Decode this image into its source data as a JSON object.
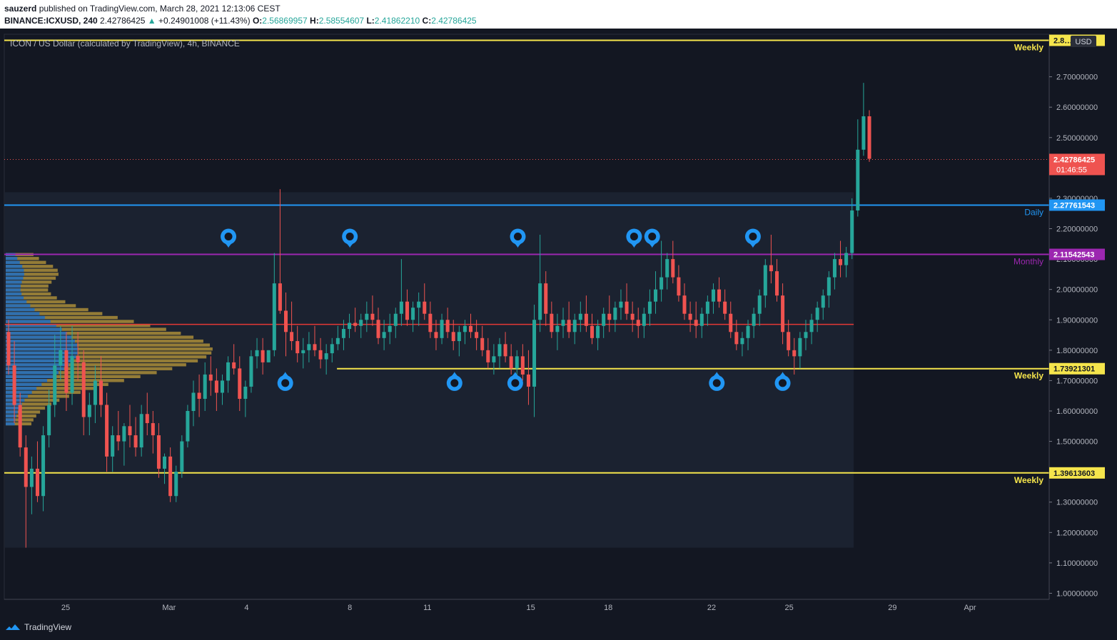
{
  "header": {
    "author": "sauzerd",
    "published_text": "published on TradingView.com, March 28, 2021 12:13:06 CEST",
    "symbol_tf": "BINANCE:ICXUSD, 240",
    "last": "2.42786425",
    "change": "+0.24901008 (+11.43%)",
    "o_label": "O:",
    "o": "2.56869957",
    "h_label": "H:",
    "h": "2.58554607",
    "l_label": "L:",
    "l": "2.41862210",
    "c_label": "C:",
    "c": "2.42786425"
  },
  "legend": "ICON / US Dollar (calculated by TradingView), 4h, BINANCE",
  "currency": "USD",
  "colors": {
    "up": "#26a69a",
    "down": "#ef5350",
    "bg": "#131722",
    "weekly": "#f5e54c",
    "daily": "#2196f3",
    "monthly": "#9c27b0",
    "poc": "#e53935",
    "marker": "#2196f3",
    "vp_up": "#1e6fc4",
    "vp_down": "#c7a33a"
  },
  "footer": {
    "brand": "TradingView",
    "logo_icon": "tradingview-cloud-icon"
  },
  "chart_data": {
    "type": "candlestick",
    "title": "ICON / US Dollar (calculated by TradingView), 4h, BINANCE",
    "ylim": [
      0.98,
      2.84
    ],
    "y_ticks": [
      1.0,
      1.1,
      1.2,
      1.3,
      1.4,
      1.5,
      1.6,
      1.7,
      1.8,
      1.9,
      2.0,
      2.1,
      2.2,
      2.3,
      2.5,
      2.6,
      2.7
    ],
    "y_tick_labels": [
      "1.00000000",
      "1.10000000",
      "1.20000000",
      "1.30000000",
      "1.40000000",
      "1.50000000",
      "1.60000000",
      "1.70000000",
      "1.80000000",
      "1.90000000",
      "2.00000000",
      "2.10000000",
      "2.20000000",
      "2.30000000",
      "2.50000000",
      "2.60000000",
      "2.70000000"
    ],
    "x_ticks": [
      {
        "label": "25",
        "day": 0
      },
      {
        "label": "Mar",
        "day": 4
      },
      {
        "label": "4",
        "day": 7
      },
      {
        "label": "8",
        "day": 11
      },
      {
        "label": "11",
        "day": 14
      },
      {
        "label": "15",
        "day": 18
      },
      {
        "label": "18",
        "day": 21
      },
      {
        "label": "22",
        "day": 25
      },
      {
        "label": "25",
        "day": 28
      },
      {
        "label": "29",
        "day": 32
      },
      {
        "label": "Apr",
        "day": 35
      }
    ],
    "levels": [
      {
        "price": 2.82,
        "label": "Weekly",
        "value_label": "2.8…24",
        "color": "#f5e54c",
        "value_box": "weekly"
      },
      {
        "price": 2.27761543,
        "label": "Daily",
        "value_label": "2.27761543",
        "color": "#2196f3",
        "value_box": "daily"
      },
      {
        "price": 2.11542543,
        "label": "Monthly",
        "value_label": "2.11542543",
        "color": "#9c27b0",
        "value_box": "monthly"
      },
      {
        "price": 1.73921301,
        "label": "Weekly",
        "value_label": "1.73921301",
        "color": "#f5e54c",
        "value_box": "weekly",
        "start_day": 10.5
      },
      {
        "price": 1.39613603,
        "label": "Weekly",
        "value_label": "1.39613603",
        "color": "#f5e54c",
        "value_box": "weekly"
      }
    ],
    "poc_line": {
      "price": 1.885,
      "start_day": -2.35,
      "end_day": 30.5
    },
    "last_price": {
      "value": 2.42786425,
      "label": "2.42786425",
      "countdown": "01:46:55"
    },
    "markers_top_days": [
      6.3,
      11.0,
      17.5,
      22.0,
      22.7,
      26.6
    ],
    "markers_bottom_days": [
      8.5,
      15.05,
      17.4,
      25.2,
      27.75
    ],
    "ohlc": [
      [
        1.86,
        1.9,
        1.72,
        1.75
      ],
      [
        1.75,
        1.83,
        1.56,
        1.62
      ],
      [
        1.62,
        1.66,
        1.45,
        1.48
      ],
      [
        1.48,
        1.52,
        1.15,
        1.35
      ],
      [
        1.35,
        1.45,
        1.26,
        1.41
      ],
      [
        1.41,
        1.5,
        1.3,
        1.32
      ],
      [
        1.32,
        1.55,
        1.27,
        1.52
      ],
      [
        1.52,
        1.67,
        1.48,
        1.62
      ],
      [
        1.62,
        1.85,
        1.58,
        1.75
      ],
      [
        1.75,
        1.88,
        1.7,
        1.8
      ],
      [
        1.8,
        1.86,
        1.6,
        1.66
      ],
      [
        1.66,
        1.88,
        1.62,
        1.78
      ],
      [
        1.78,
        1.86,
        1.7,
        1.76
      ],
      [
        1.76,
        1.8,
        1.52,
        1.58
      ],
      [
        1.58,
        1.66,
        1.52,
        1.62
      ],
      [
        1.62,
        1.75,
        1.56,
        1.7
      ],
      [
        1.7,
        1.78,
        1.58,
        1.62
      ],
      [
        1.62,
        1.66,
        1.4,
        1.45
      ],
      [
        1.45,
        1.55,
        1.4,
        1.52
      ],
      [
        1.52,
        1.6,
        1.47,
        1.5
      ],
      [
        1.5,
        1.56,
        1.42,
        1.55
      ],
      [
        1.55,
        1.62,
        1.48,
        1.52
      ],
      [
        1.52,
        1.58,
        1.45,
        1.48
      ],
      [
        1.48,
        1.62,
        1.45,
        1.59
      ],
      [
        1.59,
        1.66,
        1.52,
        1.56
      ],
      [
        1.56,
        1.6,
        1.46,
        1.52
      ],
      [
        1.52,
        1.56,
        1.38,
        1.41
      ],
      [
        1.41,
        1.46,
        1.36,
        1.45
      ],
      [
        1.45,
        1.48,
        1.3,
        1.32
      ],
      [
        1.32,
        1.42,
        1.3,
        1.4
      ],
      [
        1.4,
        1.52,
        1.38,
        1.5
      ],
      [
        1.5,
        1.62,
        1.48,
        1.6
      ],
      [
        1.6,
        1.7,
        1.55,
        1.66
      ],
      [
        1.66,
        1.72,
        1.58,
        1.64
      ],
      [
        1.64,
        1.76,
        1.6,
        1.72
      ],
      [
        1.72,
        1.78,
        1.65,
        1.7
      ],
      [
        1.7,
        1.74,
        1.6,
        1.66
      ],
      [
        1.66,
        1.72,
        1.62,
        1.7
      ],
      [
        1.7,
        1.78,
        1.66,
        1.76
      ],
      [
        1.76,
        1.82,
        1.72,
        1.74
      ],
      [
        1.74,
        1.78,
        1.6,
        1.64
      ],
      [
        1.64,
        1.7,
        1.58,
        1.68
      ],
      [
        1.68,
        1.8,
        1.66,
        1.78
      ],
      [
        1.78,
        1.84,
        1.74,
        1.8
      ],
      [
        1.8,
        1.84,
        1.72,
        1.76
      ],
      [
        1.76,
        1.8,
        1.76,
        1.8
      ],
      [
        1.8,
        2.12,
        1.78,
        2.02
      ],
      [
        2.02,
        2.33,
        1.92,
        1.93
      ],
      [
        1.93,
        1.99,
        1.78,
        1.86
      ],
      [
        1.86,
        1.96,
        1.8,
        1.83
      ],
      [
        1.83,
        1.88,
        1.76,
        1.79
      ],
      [
        1.79,
        1.84,
        1.74,
        1.8
      ],
      [
        1.8,
        1.86,
        1.76,
        1.82
      ],
      [
        1.82,
        1.88,
        1.78,
        1.8
      ],
      [
        1.8,
        1.84,
        1.74,
        1.77
      ],
      [
        1.77,
        1.82,
        1.72,
        1.79
      ],
      [
        1.79,
        1.84,
        1.76,
        1.82
      ],
      [
        1.82,
        1.88,
        1.8,
        1.84
      ],
      [
        1.84,
        1.9,
        1.8,
        1.87
      ],
      [
        1.87,
        1.92,
        1.84,
        1.89
      ],
      [
        1.89,
        1.94,
        1.86,
        1.88
      ],
      [
        1.88,
        1.92,
        1.84,
        1.9
      ],
      [
        1.9,
        1.96,
        1.86,
        1.92
      ],
      [
        1.92,
        1.98,
        1.88,
        1.9
      ],
      [
        1.9,
        1.94,
        1.82,
        1.84
      ],
      [
        1.84,
        1.9,
        1.8,
        1.86
      ],
      [
        1.86,
        1.92,
        1.82,
        1.88
      ],
      [
        1.88,
        1.94,
        1.84,
        1.92
      ],
      [
        1.92,
        2.1,
        1.88,
        1.96
      ],
      [
        1.96,
        2.0,
        1.88,
        1.9
      ],
      [
        1.9,
        1.96,
        1.86,
        1.94
      ],
      [
        1.94,
        1.99,
        1.88,
        1.96
      ],
      [
        1.96,
        2.02,
        1.9,
        1.92
      ],
      [
        1.92,
        1.96,
        1.84,
        1.86
      ],
      [
        1.86,
        1.9,
        1.8,
        1.84
      ],
      [
        1.84,
        1.92,
        1.82,
        1.9
      ],
      [
        1.9,
        1.94,
        1.84,
        1.86
      ],
      [
        1.86,
        1.9,
        1.8,
        1.83
      ],
      [
        1.83,
        1.88,
        1.78,
        1.86
      ],
      [
        1.86,
        1.9,
        1.82,
        1.88
      ],
      [
        1.88,
        1.92,
        1.84,
        1.86
      ],
      [
        1.86,
        1.9,
        1.8,
        1.84
      ],
      [
        1.84,
        1.88,
        1.78,
        1.8
      ],
      [
        1.8,
        1.84,
        1.74,
        1.76
      ],
      [
        1.76,
        1.82,
        1.72,
        1.78
      ],
      [
        1.78,
        1.84,
        1.74,
        1.82
      ],
      [
        1.82,
        1.86,
        1.76,
        1.78
      ],
      [
        1.78,
        1.82,
        1.72,
        1.74
      ],
      [
        1.74,
        1.8,
        1.72,
        1.78
      ],
      [
        1.78,
        1.82,
        1.7,
        1.72
      ],
      [
        1.72,
        1.8,
        1.62,
        1.68
      ],
      [
        1.68,
        1.95,
        1.58,
        1.9
      ],
      [
        1.9,
        2.18,
        1.86,
        2.02
      ],
      [
        2.02,
        2.06,
        1.88,
        1.92
      ],
      [
        1.92,
        1.96,
        1.84,
        1.86
      ],
      [
        1.86,
        1.92,
        1.8,
        1.88
      ],
      [
        1.88,
        1.94,
        1.84,
        1.9
      ],
      [
        1.9,
        1.96,
        1.84,
        1.86
      ],
      [
        1.86,
        1.92,
        1.82,
        1.9
      ],
      [
        1.9,
        1.96,
        1.86,
        1.92
      ],
      [
        1.92,
        1.98,
        1.86,
        1.88
      ],
      [
        1.88,
        1.92,
        1.82,
        1.84
      ],
      [
        1.84,
        1.9,
        1.8,
        1.88
      ],
      [
        1.88,
        1.94,
        1.84,
        1.92
      ],
      [
        1.92,
        1.98,
        1.86,
        1.9
      ],
      [
        1.9,
        1.96,
        1.86,
        1.94
      ],
      [
        1.94,
        2.0,
        1.9,
        1.96
      ],
      [
        1.96,
        2.02,
        1.9,
        1.92
      ],
      [
        1.92,
        1.96,
        1.86,
        1.9
      ],
      [
        1.9,
        1.94,
        1.84,
        1.88
      ],
      [
        1.88,
        1.94,
        1.84,
        1.92
      ],
      [
        1.92,
        2.0,
        1.88,
        1.96
      ],
      [
        1.96,
        2.06,
        1.92,
        2.0
      ],
      [
        2.0,
        2.16,
        1.96,
        2.04
      ],
      [
        2.04,
        2.12,
        2.0,
        2.1
      ],
      [
        2.1,
        2.16,
        2.02,
        2.04
      ],
      [
        2.04,
        2.08,
        1.96,
        1.98
      ],
      [
        1.98,
        2.02,
        1.9,
        1.92
      ],
      [
        1.92,
        1.96,
        1.86,
        1.9
      ],
      [
        1.9,
        1.96,
        1.84,
        1.88
      ],
      [
        1.88,
        1.94,
        1.84,
        1.92
      ],
      [
        1.92,
        1.98,
        1.88,
        1.96
      ],
      [
        1.96,
        2.02,
        1.92,
        2.0
      ],
      [
        2.0,
        2.04,
        1.94,
        1.96
      ],
      [
        1.96,
        2.0,
        1.9,
        1.92
      ],
      [
        1.92,
        1.96,
        1.84,
        1.86
      ],
      [
        1.86,
        1.9,
        1.8,
        1.82
      ],
      [
        1.82,
        1.86,
        1.78,
        1.84
      ],
      [
        1.84,
        1.9,
        1.8,
        1.88
      ],
      [
        1.88,
        1.94,
        1.84,
        1.92
      ],
      [
        1.92,
        2.0,
        1.88,
        1.98
      ],
      [
        1.98,
        2.1,
        1.94,
        2.08
      ],
      [
        2.08,
        2.18,
        2.02,
        2.06
      ],
      [
        2.06,
        2.1,
        1.96,
        1.98
      ],
      [
        1.98,
        2.02,
        1.82,
        1.86
      ],
      [
        1.86,
        1.9,
        1.78,
        1.8
      ],
      [
        1.8,
        1.84,
        1.72,
        1.78
      ],
      [
        1.78,
        1.86,
        1.74,
        1.84
      ],
      [
        1.84,
        1.9,
        1.8,
        1.86
      ],
      [
        1.86,
        1.92,
        1.82,
        1.9
      ],
      [
        1.9,
        1.96,
        1.86,
        1.94
      ],
      [
        1.94,
        2.0,
        1.9,
        1.98
      ],
      [
        1.98,
        2.06,
        1.94,
        2.04
      ],
      [
        2.04,
        2.12,
        2.0,
        2.1
      ],
      [
        2.1,
        2.16,
        2.04,
        2.08
      ],
      [
        2.08,
        2.14,
        2.04,
        2.12
      ],
      [
        2.12,
        2.3,
        2.1,
        2.26
      ],
      [
        2.26,
        2.56,
        2.24,
        2.46
      ],
      [
        2.46,
        2.68,
        2.44,
        2.57
      ],
      [
        2.57,
        2.59,
        2.42,
        2.43
      ]
    ],
    "volume_profile_note": "visible range volume profile on left side",
    "ranges_box": {
      "x_from_day": -2.35,
      "x_to_day": 30.5,
      "price_from": 1.15,
      "price_to": 2.32
    }
  }
}
